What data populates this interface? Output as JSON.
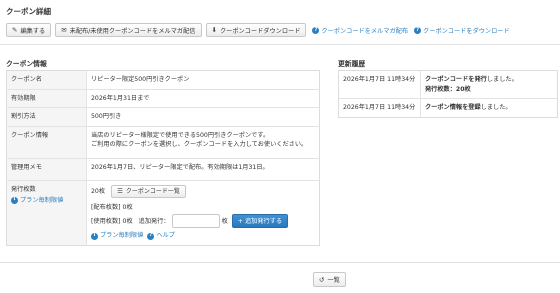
{
  "page": {
    "title": "クーポン詳細"
  },
  "toolbar": {
    "edit_label": "編集する",
    "mail_label": "未配布/未使用クーポンコードをメルマガ配信",
    "download_label": "クーポンコードダウンロード",
    "help_mail_link": "クーポンコードをメルマガ配布",
    "help_download_link": "クーポンコードをダウンロード"
  },
  "info": {
    "section_title": "クーポン情報",
    "rows": [
      {
        "label": "クーポン名",
        "value": "リピーター限定500円引きクーポン"
      },
      {
        "label": "有効期限",
        "value": "2026年1月31日まで"
      },
      {
        "label": "割引方法",
        "value": "500円引き"
      },
      {
        "label": "クーポン情報",
        "value_line1": "当店のリピーター様限定で使用できる500円引きクーポンです。",
        "value_line2": "ご利用の際にクーポンを選択し、クーポンコードを入力してお使いください。"
      },
      {
        "label": "管理用メモ",
        "value": "2026年1月7日、リピーター限定で配布。有効期限は1月31日。"
      }
    ],
    "issue": {
      "label": "発行枚数",
      "plan_link": "プラン毎制限値",
      "count": "20枚",
      "list_button": "クーポンコード一覧",
      "distributed": "[配布枚数] 0枚",
      "used": "[使用枚数] 0枚",
      "add_label": "追加発行：",
      "unit": "枚",
      "add_value": "",
      "add_button": "追加発行する",
      "plan_link2": "プラン毎制限値",
      "help_link": "ヘルプ"
    }
  },
  "history": {
    "section_title": "更新履歴",
    "rows": [
      {
        "date": "2026年1月7日 11時34分",
        "action": "クーポンコードを発行",
        "suffix": "しました。",
        "detail": "発行枚数：20枚"
      },
      {
        "date": "2026年1月7日 11時34分",
        "action": "クーポン情報を登録",
        "suffix": "しました。",
        "detail": ""
      }
    ]
  },
  "footer": {
    "back_label": "一覧"
  },
  "icons": {
    "edit": "edit-icon",
    "mail": "envelope-icon",
    "download": "download-icon",
    "help": "question-circle-icon",
    "info": "info-circle-icon",
    "list": "list-icon",
    "plus": "plus-icon",
    "back": "back-arrow-icon"
  },
  "colors": {
    "link": "#2a7fc1",
    "primary": "#2a78bc"
  }
}
